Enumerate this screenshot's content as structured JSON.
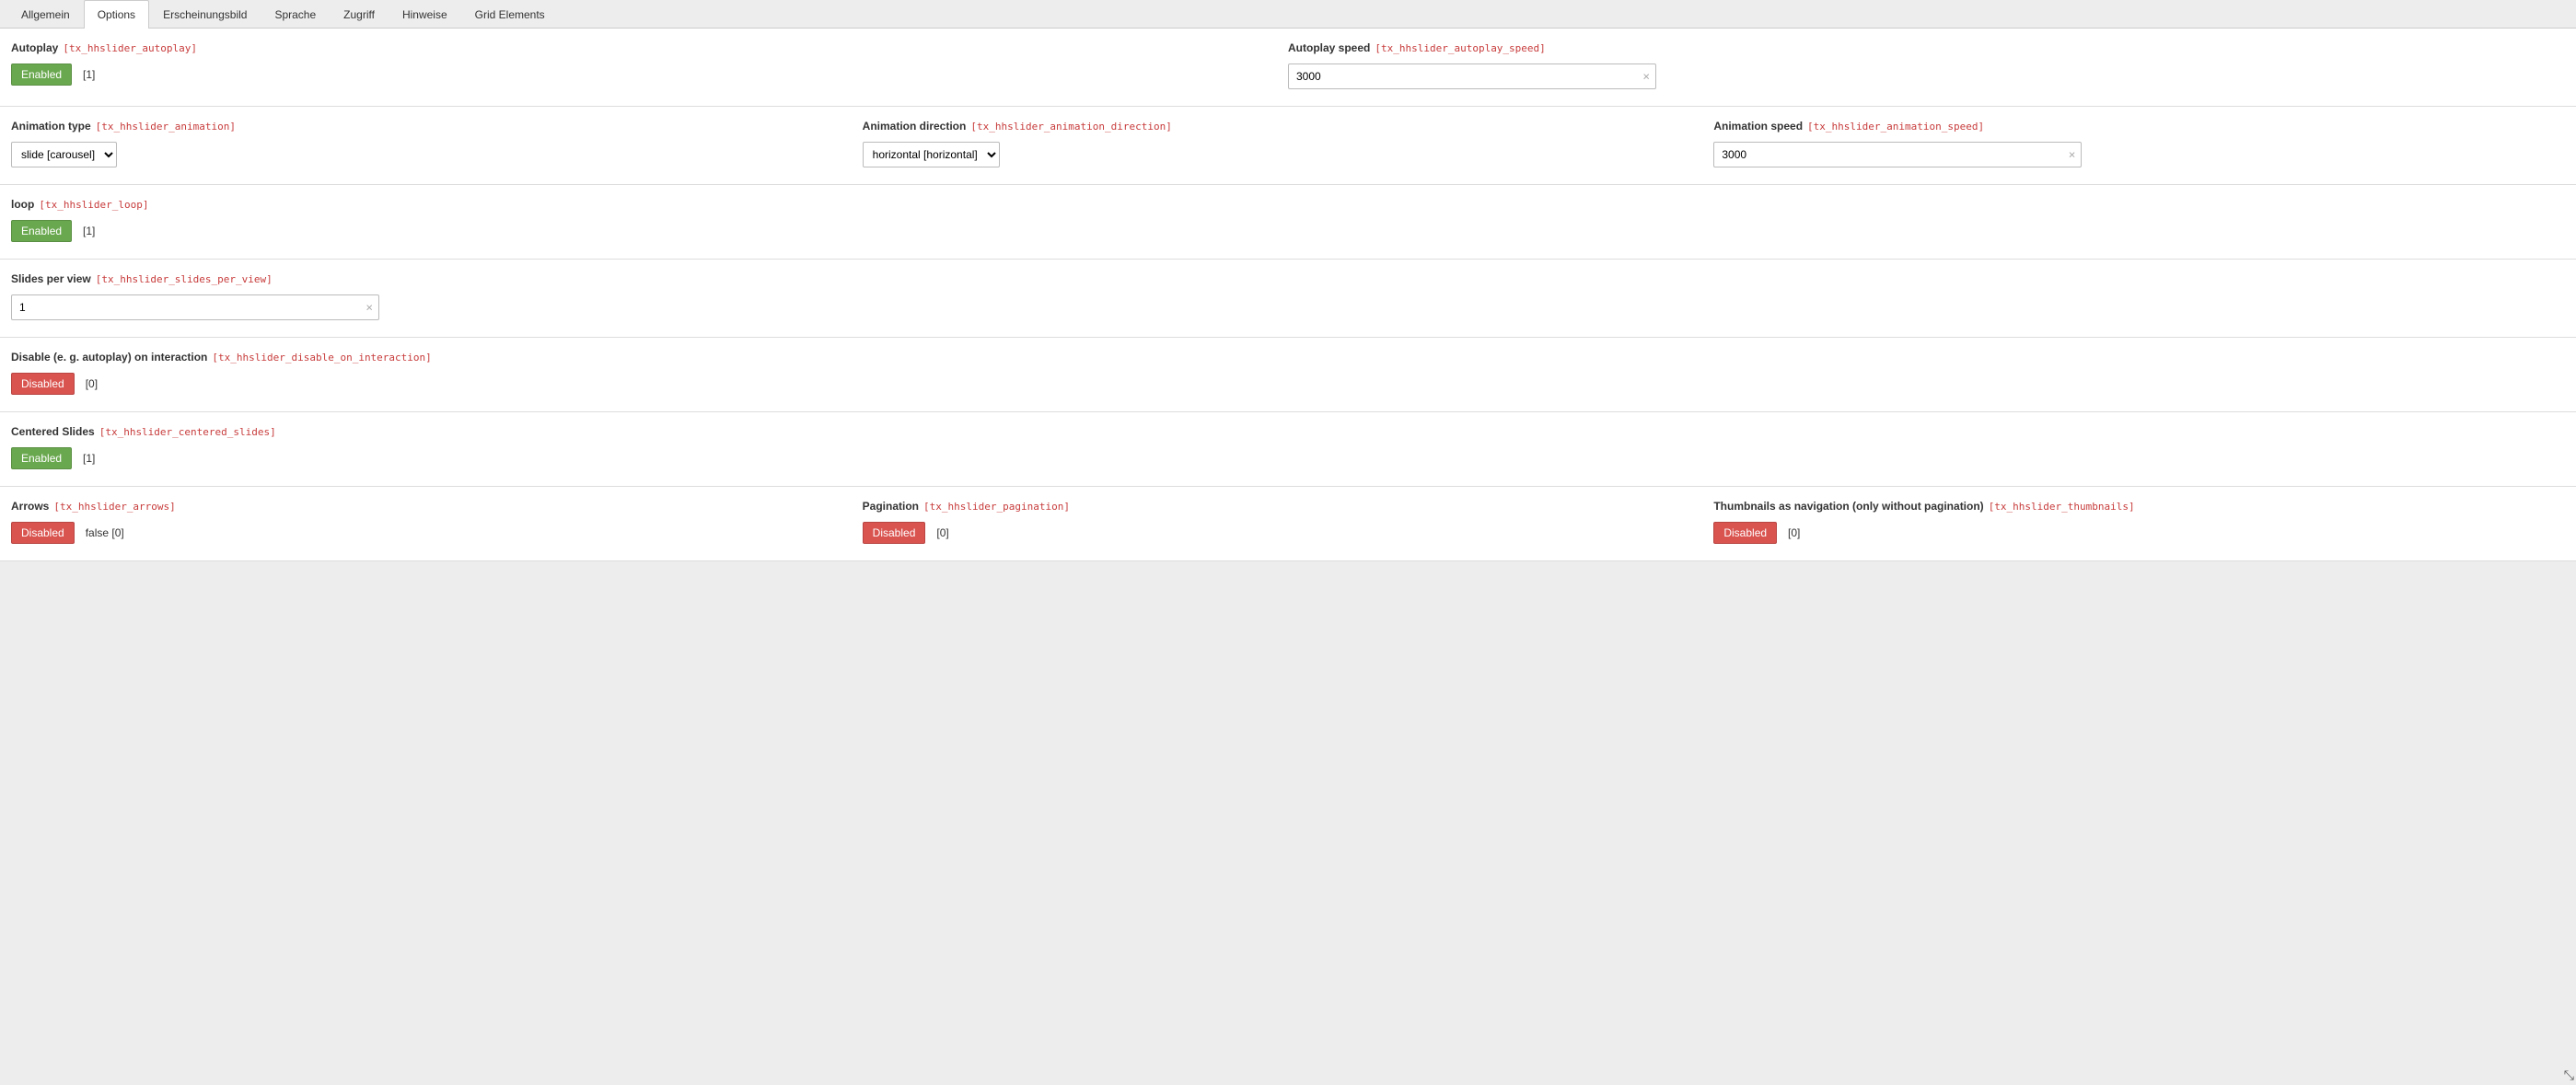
{
  "tabs": {
    "allgemein": "Allgemein",
    "options": "Options",
    "erscheinungsbild": "Erscheinungsbild",
    "sprache": "Sprache",
    "zugriff": "Zugriff",
    "hinweise": "Hinweise",
    "grid_elements": "Grid Elements"
  },
  "controls": {
    "enabled_label": "Enabled",
    "disabled_label": "Disabled"
  },
  "fields": {
    "autoplay": {
      "label": "Autoplay",
      "tech": "[tx_hhslider_autoplay]",
      "state": "[1]"
    },
    "autoplay_speed": {
      "label": "Autoplay speed",
      "tech": "[tx_hhslider_autoplay_speed]",
      "value": "3000"
    },
    "animation_type": {
      "label": "Animation type",
      "tech": "[tx_hhslider_animation]",
      "value": "slide [carousel]"
    },
    "animation_direction": {
      "label": "Animation direction",
      "tech": "[tx_hhslider_animation_direction]",
      "value": "horizontal [horizontal]"
    },
    "animation_speed": {
      "label": "Animation speed",
      "tech": "[tx_hhslider_animation_speed]",
      "value": "3000"
    },
    "loop": {
      "label": "loop",
      "tech": "[tx_hhslider_loop]",
      "state": "[1]"
    },
    "slides_per_view": {
      "label": "Slides per view",
      "tech": "[tx_hhslider_slides_per_view]",
      "value": "1"
    },
    "disable_on_interaction": {
      "label": "Disable (e. g. autoplay) on interaction",
      "tech": "[tx_hhslider_disable_on_interaction]",
      "state": "[0]"
    },
    "centered_slides": {
      "label": "Centered Slides",
      "tech": "[tx_hhslider_centered_slides]",
      "state": "[1]"
    },
    "arrows": {
      "label": "Arrows",
      "tech": "[tx_hhslider_arrows]",
      "state": "false [0]"
    },
    "pagination": {
      "label": "Pagination",
      "tech": "[tx_hhslider_pagination]",
      "state": "[0]"
    },
    "thumbnails": {
      "label": "Thumbnails as navigation (only without pagination)",
      "tech": "[tx_hhslider_thumbnails]",
      "state": "[0]"
    }
  }
}
